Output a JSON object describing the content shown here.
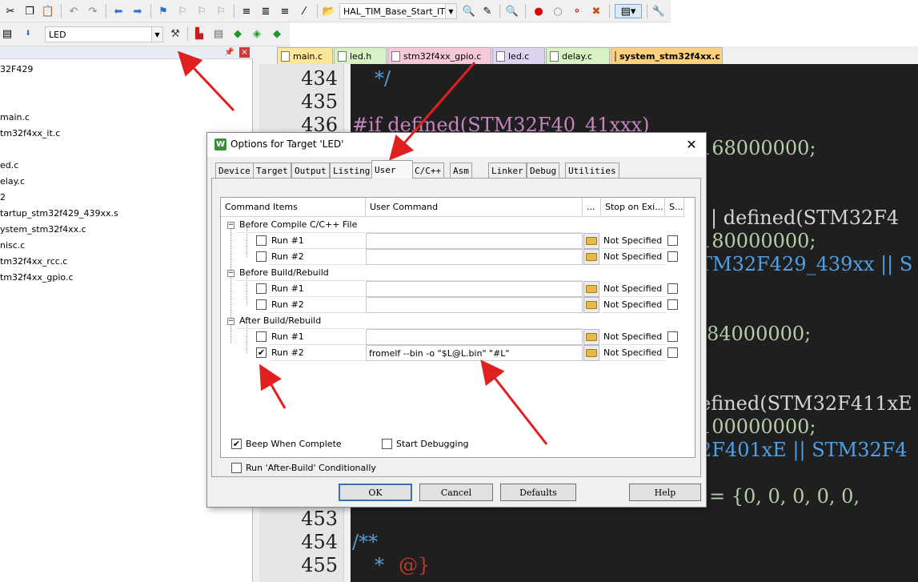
{
  "toolbar": {
    "function_combo": "HAL_TIM_Base_Start_IT",
    "target_combo": "LED"
  },
  "project": {
    "root": "32F429",
    "files": [
      "main.c",
      "tm32f4xx_it.c",
      "ed.c",
      "elay.c",
      "2",
      "tartup_stm32f429_439xx.s",
      "ystem_stm32f4xx.c",
      "nisc.c",
      "tm32f4xx_rcc.c",
      "tm32f4xx_gpio.c"
    ]
  },
  "editor": {
    "tabs": [
      {
        "label": "main.c",
        "color": "#ffe79a"
      },
      {
        "label": "led.h",
        "color": "#d9f2c4"
      },
      {
        "label": "stm32f4xx_gpio.c",
        "color": "#f6c9da"
      },
      {
        "label": "led.c",
        "color": "#ddd4f2"
      },
      {
        "label": "delay.c",
        "color": "#d9f2c4"
      },
      {
        "label": "system_stm32f4xx.c",
        "color": "#ffd17a"
      }
    ],
    "line_numbers": {
      "n434": "434",
      "n435": "435",
      "n436": "436",
      "n453": "453",
      "n454": "454",
      "n455": "455"
    },
    "code": {
      "l434": "*/",
      "l436": "#if defined(STM32F40_41xxx)",
      "c1": "168000000;",
      "c2": "| defined(STM32F4",
      "c3": "180000000;",
      "c4": "TM32F429_439xx || S",
      "c5": "84000000;",
      "c6": "efined(STM32F411xE",
      "c7": "100000000;",
      "c8": "2F401xE || STM32F4",
      "c9": "= {0, 0, 0, 0, 0,",
      "l454": "/**",
      "l455_star": "*",
      "l455_tag": "@}"
    }
  },
  "dialog": {
    "title": "Options for Target 'LED'",
    "tabs": [
      "Device",
      "Target",
      "Output",
      "Listing",
      "User",
      "C/C++",
      "Asm",
      "Linker",
      "Debug",
      "Utilities"
    ],
    "active_tab": "User",
    "columns": [
      "Command Items",
      "User Command",
      "...",
      "Stop on Exi...",
      "S..."
    ],
    "groups": [
      {
        "label": "Before Compile C/C++ File",
        "runs": [
          {
            "label": "Run #1",
            "checked": false,
            "command": "",
            "stop": "Not Specified"
          },
          {
            "label": "Run #2",
            "checked": false,
            "command": "",
            "stop": "Not Specified"
          }
        ]
      },
      {
        "label": "Before Build/Rebuild",
        "runs": [
          {
            "label": "Run #1",
            "checked": false,
            "command": "",
            "stop": "Not Specified"
          },
          {
            "label": "Run #2",
            "checked": false,
            "command": "",
            "stop": "Not Specified"
          }
        ]
      },
      {
        "label": "After Build/Rebuild",
        "runs": [
          {
            "label": "Run #1",
            "checked": false,
            "command": "",
            "stop": "Not Specified"
          },
          {
            "label": "Run #2",
            "checked": true,
            "command": "fromelf --bin -o \"$L@L.bin\" \"#L\"",
            "stop": "Not Specified"
          }
        ]
      }
    ],
    "options": {
      "run_after_build": "Run 'After-Build' Conditionally",
      "beep": "Beep When Complete",
      "start_debugging": "Start Debugging"
    },
    "buttons": {
      "ok": "OK",
      "cancel": "Cancel",
      "defaults": "Defaults",
      "help": "Help"
    }
  },
  "colors": {
    "code_bg": "#1f1f1f",
    "code_text": "#d4d4d4",
    "code_number": "#b5cea8",
    "code_macro": "#4fa0e6",
    "code_comment": "#569cd6",
    "code_keyword": "#c586c0",
    "annotation_arrow": "#e0201f"
  }
}
